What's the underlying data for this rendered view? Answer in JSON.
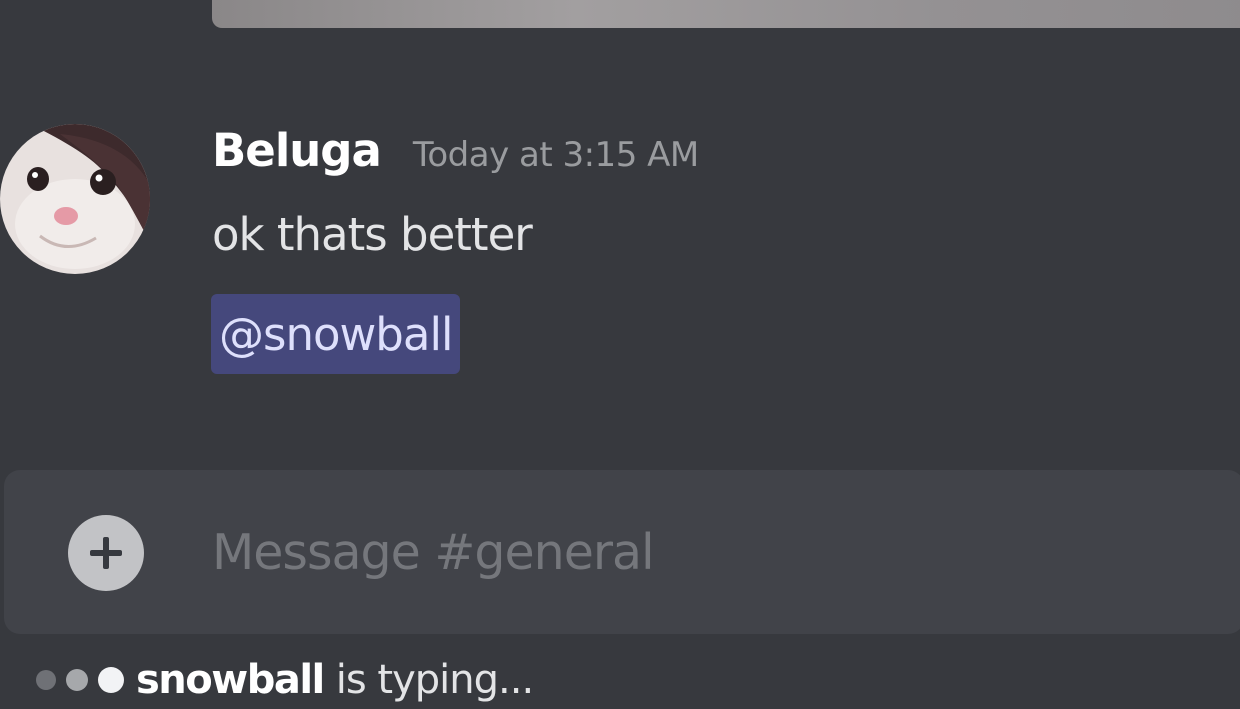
{
  "message": {
    "author": "Beluga",
    "timestamp": "Today at 3:15 AM",
    "text": "ok thats better",
    "mention": "@snowball",
    "avatar_icon": "white-cat-face-avatar"
  },
  "composer": {
    "placeholder": "Message #general",
    "add_icon": "plus-icon"
  },
  "typing_indicator": {
    "user": "snowball",
    "suffix": "is typing..."
  },
  "colors": {
    "background": "#37393e",
    "composer": "#414349",
    "mention_bg": "#45487c",
    "mention_text": "#dee0fc"
  }
}
